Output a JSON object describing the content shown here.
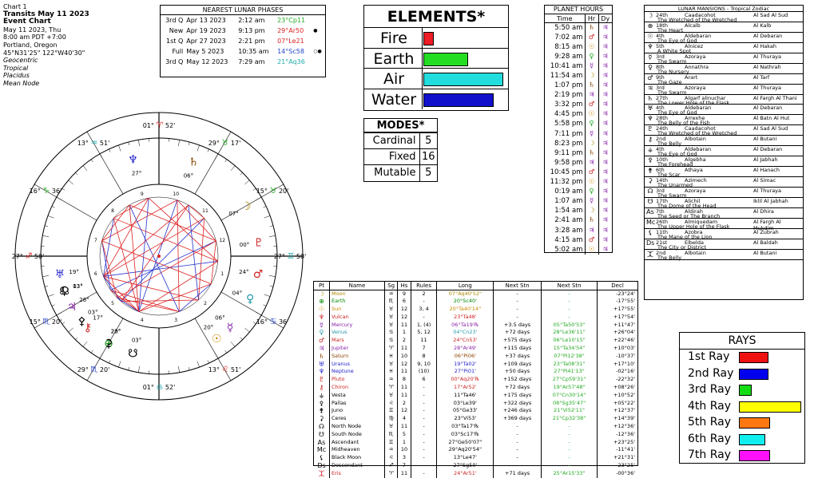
{
  "info": {
    "line1": "Chart 1",
    "line2": "Transits May 11 2023",
    "line3": "Event Chart",
    "line4": "May 11 2023, Thu",
    "line5": "8:00 am  PDT +7:00",
    "line6": "Portland, Oregon",
    "line7": "45°N31'25\"  122°W40'30\"",
    "line8": "Geocentric",
    "line9": "Tropical",
    "line10": "Placidus",
    "line11": "Mean Node"
  },
  "phases": {
    "title": "NEAREST LUNAR PHASES",
    "rows": [
      {
        "phase": "3rd Q",
        "date": "Apr 13 2023",
        "time": "2:12 am",
        "pos": "23°Cp11",
        "color": "#22aa22",
        "mark": ""
      },
      {
        "phase": "New",
        "date": "Apr 19 2023",
        "time": "9:13 pm",
        "pos": "29°Ar50",
        "color": "#dd2222",
        "mark": "●"
      },
      {
        "phase": "1st Q",
        "date": "Apr 27 2023",
        "time": "2:21 pm",
        "pos": "07°Le21",
        "color": "#dd2222",
        "mark": ""
      },
      {
        "phase": "Full",
        "date": "May 5 2023",
        "time": "10:35 am",
        "pos": "14°Sc58",
        "color": "#2244cc",
        "mark": "○●"
      },
      {
        "phase": "3rd Q",
        "date": "May 12 2023",
        "time": "7:29 am",
        "pos": "21°Aq36",
        "color": "#22aaaa",
        "mark": ""
      }
    ]
  },
  "elements": {
    "title": "ELEMENTS*",
    "items": [
      {
        "label": "Fire",
        "value": 2,
        "color": "#ee1c24"
      },
      {
        "label": "Earth",
        "value": 9,
        "color": "#22dd22"
      },
      {
        "label": "Air",
        "value": 16,
        "color": "#22dddd"
      },
      {
        "label": "Water",
        "value": 14,
        "color": "#1111cc"
      }
    ],
    "max": 16
  },
  "modes": {
    "title": "MODES*",
    "items": [
      {
        "label": "Cardinal",
        "value": "5"
      },
      {
        "label": "Fixed",
        "value": "16"
      },
      {
        "label": "Mutable",
        "value": "5"
      }
    ]
  },
  "hours": {
    "title": "PLANET HOURS",
    "headers": [
      "Time",
      "Hr",
      "Dy"
    ],
    "rows": [
      [
        "5:50 am",
        "♄",
        "♃"
      ],
      [
        "7:02 am",
        "♂",
        "♃"
      ],
      [
        "8:15 am",
        "☉",
        "♃"
      ],
      [
        "9:28 am",
        "♀",
        "♃"
      ],
      [
        "10:41 am",
        "☿",
        "♃"
      ],
      [
        "11:54 am",
        "☽",
        "♃"
      ],
      [
        "1:07 pm",
        "♄",
        "♃"
      ],
      [
        "2:19 pm",
        "♃",
        "♃"
      ],
      [
        "3:32 pm",
        "♂",
        "♃"
      ],
      [
        "4:45 pm",
        "☉",
        "♃"
      ],
      [
        "5:58 pm",
        "♀",
        "♃"
      ],
      [
        "7:11 pm",
        "☿",
        "♃"
      ],
      [
        "8:23 pm",
        "☽",
        "♃"
      ],
      [
        "9:11 pm",
        "♄",
        "♃"
      ],
      [
        "9:58 pm",
        "♃",
        "♃"
      ],
      [
        "10:45 pm",
        "♂",
        "♃"
      ],
      [
        "11:32 pm",
        "☉",
        "♃"
      ],
      [
        "0:19 am",
        "♀",
        "♃"
      ],
      [
        "1:07 am",
        "☿",
        "♃"
      ],
      [
        "1:54 am",
        "☽",
        "♃"
      ],
      [
        "2:41 am",
        "♄",
        "♃"
      ],
      [
        "3:28 am",
        "♃",
        "♃"
      ],
      [
        "4:15 am",
        "♂",
        "♃"
      ],
      [
        "5:02 am",
        "☉",
        "♃"
      ]
    ]
  },
  "mansions": {
    "title": "LUNAR MANSIONS - Tropical Zodiac",
    "rows": [
      {
        "g": "☽",
        "n": "24th",
        "a": "Caadacohot",
        "b": "Al Sad Al Sud",
        "d": "The Wretched of the Wretched"
      },
      {
        "g": "⊕",
        "n": "18th",
        "a": "Alcalb",
        "b": "Al Kalb",
        "d": "The Heart"
      },
      {
        "g": "☉",
        "n": "4th",
        "a": "Aldebaran",
        "b": "Al Debaran",
        "d": "The Eye of God"
      },
      {
        "g": "♆",
        "n": "5th",
        "a": "Alnicez",
        "b": "Al Hakah",
        "d": "A White Spot"
      },
      {
        "g": "☿",
        "n": "3rd",
        "a": "Azoraya",
        "b": "Al Thuraya",
        "d": "The Swarm"
      },
      {
        "g": "♀",
        "n": "8th",
        "a": "Annathra",
        "b": "Al Nathrah",
        "d": "The Nursery"
      },
      {
        "g": "♂",
        "n": "9th",
        "a": "Arart",
        "b": "Al Tarf",
        "d": "The Gaze"
      },
      {
        "g": "♃",
        "n": "3rd",
        "a": "Azoraya",
        "b": "Al Thuraya",
        "d": "The Swarm"
      },
      {
        "g": "♄",
        "n": "27th",
        "a": "Algarf alinuchar",
        "b": "Al Fargh Al Thani",
        "d": "The Lower Hole of the Flask"
      },
      {
        "g": "♅",
        "n": "4th",
        "a": "Aldebaran",
        "b": "Al Debaran",
        "d": "The Eye of God"
      },
      {
        "g": "♆",
        "n": "28th",
        "a": "Arrexhe",
        "b": "Al Batn Al Hut",
        "d": "The Belly of the Fish"
      },
      {
        "g": "♇",
        "n": "24th",
        "a": "Caadacohot",
        "b": "Al Sad Al Sud",
        "d": "The Wretched of the Wretched"
      },
      {
        "g": "⚷",
        "n": "2nd",
        "a": "Albotain",
        "b": "Al Butani",
        "d": "The Belly"
      },
      {
        "g": "⚶",
        "n": "4th",
        "a": "Aldebaran",
        "b": "Al Debaran",
        "d": "The Eye of God"
      },
      {
        "g": "⚴",
        "n": "10th",
        "a": "Algebha",
        "b": "Al Jabhah",
        "d": "The Forehead"
      },
      {
        "g": "⚵",
        "n": "6th",
        "a": "Athaya",
        "b": "Al Hanach",
        "d": "The Scar"
      },
      {
        "g": "⚳",
        "n": "14th",
        "a": "Azimech",
        "b": "Al Simac",
        "d": "The Unarmed"
      },
      {
        "g": "☊",
        "n": "3rd",
        "a": "Azoraya",
        "b": "Al Thuraya",
        "d": "The Swarm"
      },
      {
        "g": "☋",
        "n": "17th",
        "a": "Alichil",
        "b": "Iklil Al Jabhah",
        "d": "The Dome of the Head"
      },
      {
        "g": "As",
        "n": "7th",
        "a": "Aldirah",
        "b": "Al Dhira",
        "d": "The Seed or The Branch"
      },
      {
        "g": "Mc",
        "n": "26th",
        "a": "Almiquedam",
        "b": "Al Fargh Al Mukdim",
        "d": "The Upper Hole of the Flask"
      },
      {
        "g": "⚸",
        "n": "11th",
        "a": "Azobra",
        "b": "Al Zubrah",
        "d": "The Mane of the Lion"
      },
      {
        "g": "Ds",
        "n": "21st",
        "a": "Elbelda",
        "b": "Al Baldah",
        "d": "The City or District"
      },
      {
        "g": "⯰",
        "n": "2nd",
        "a": "Albotain",
        "b": "Al Butani",
        "d": "The Belly"
      }
    ]
  },
  "rays": {
    "title": "RAYS",
    "items": [
      {
        "label": "1st Ray",
        "value": 0.48,
        "color": "#ee1111"
      },
      {
        "label": "2nd Ray",
        "value": 0.48,
        "color": "#0000ee"
      },
      {
        "label": "3rd Ray",
        "value": 0.2,
        "color": "#11dd11"
      },
      {
        "label": "4th Ray",
        "value": 1.0,
        "color": "#ffff00"
      },
      {
        "label": "5th Ray",
        "value": 0.5,
        "color": "#ff7711"
      },
      {
        "label": "6th Ray",
        "value": 0.42,
        "color": "#11eeee"
      },
      {
        "label": "7th Ray",
        "value": 0.5,
        "color": "#ff11ff"
      }
    ]
  },
  "ptable": {
    "headers": [
      "Pt",
      "Name",
      "Sg",
      "Hs",
      "Rules",
      "Long",
      "Next Stn",
      "Next Stn",
      "Decl"
    ],
    "rows": [
      {
        "g": "☽",
        "name": "Moon",
        "sg": "♒",
        "hs": "9",
        "ru": "2",
        "long": "07°Aq40'52\"",
        "n1": "-",
        "n2": "-",
        "decl": "-23°24'",
        "col": "#aa8800"
      },
      {
        "g": "⊕",
        "name": "Earth",
        "sg": "♏",
        "hs": "6",
        "ru": "-",
        "long": "20°Sc40'",
        "n1": "-",
        "n2": "-",
        "decl": "-17°55'",
        "col": "#008800"
      },
      {
        "g": "☉",
        "name": "Sun",
        "sg": "♉",
        "hs": "12",
        "ru": "3, 4",
        "long": "20°Ta40'14\"",
        "n1": "-",
        "n2": "-",
        "decl": "+17°55'",
        "col": "#cc8800"
      },
      {
        "g": "♆",
        "name": "Vulcan",
        "sg": "♉",
        "hs": "12",
        "ru": "-",
        "long": "23°Ta48'",
        "n1": "-",
        "n2": "-",
        "decl": "+17°54'",
        "col": "#cc2222"
      },
      {
        "g": "☿",
        "name": "Mercury",
        "sg": "♉",
        "hs": "11",
        "ru": "1, (4)",
        "long": "06°Ta19'℞",
        "n1": "+3.5 days",
        "n2": "05°Ta50'53\"",
        "decl": "+11°47'",
        "col": "#8822aa"
      },
      {
        "g": "♀",
        "name": "Venus",
        "sg": "♋",
        "hs": "1",
        "ru": "5, 12",
        "long": "04°Cn23'",
        "n1": "+72 days",
        "n2": "28°Le36'11\"",
        "decl": "+26°04'",
        "col": "#2299aa"
      },
      {
        "g": "♂",
        "name": "Mars",
        "sg": "♋",
        "hs": "2",
        "ru": "11",
        "long": "24°Cn53'",
        "n1": "+575 days",
        "n2": "06°Le10'15\"",
        "decl": "+22°46'",
        "col": "#cc2222"
      },
      {
        "g": "♃",
        "name": "Jupiter",
        "sg": "♈",
        "hs": "11",
        "ru": "7",
        "long": "28°Ar49'",
        "n1": "+115 days",
        "n2": "15°Ta34'54\"",
        "decl": "+10°03'",
        "col": "#8822aa"
      },
      {
        "g": "♄",
        "name": "Saturn",
        "sg": "♓",
        "hs": "10",
        "ru": "8",
        "long": "06°Pi06'",
        "n1": "+37 days",
        "n2": "07°Pi12'38\"",
        "decl": "-10°37'",
        "col": "#884400"
      },
      {
        "g": "♅",
        "name": "Uranus",
        "sg": "♉",
        "hs": "12",
        "ru": "9, 10",
        "long": "19°Ta02'",
        "n1": "+109 days",
        "n2": "23°Ta08'31\"",
        "decl": "+17°10'",
        "col": "#2222cc"
      },
      {
        "g": "♆",
        "name": "Neptune",
        "sg": "♓",
        "hs": "11",
        "ru": "(10)",
        "long": "27°Pi01'",
        "n1": "+50 days",
        "n2": "27°Pi41'13\"",
        "decl": "-02°16'",
        "col": "#2222cc"
      },
      {
        "g": "♇",
        "name": "Pluto",
        "sg": "♒",
        "hs": "8",
        "ru": "6",
        "long": "00°Aq20'℞",
        "n1": "+152 days",
        "n2": "27°Cp59'31\"",
        "decl": "-22°32'",
        "col": "#cc2222"
      },
      {
        "g": "⚷",
        "name": "Chiron",
        "sg": "♈",
        "hs": "11",
        "ru": "-",
        "long": "17°Ar52'",
        "n1": "+72 days",
        "n2": "19°Ar57'48\"",
        "decl": "+08°26'",
        "col": "#cc2222"
      },
      {
        "g": "⚶",
        "name": "Vesta",
        "sg": "♉",
        "hs": "11",
        "ru": "-",
        "long": "11°Ta46'",
        "n1": "+175 days",
        "n2": "07°Cn30'14\"",
        "decl": "+10°52'",
        "col": "#000000"
      },
      {
        "g": "⚴",
        "name": "Pallas",
        "sg": "♌",
        "hs": "2",
        "ru": "-",
        "long": "03°Le39'",
        "n1": "+322 days",
        "n2": "08°Sg35'47\"",
        "decl": "+05°22'",
        "col": "#000000"
      },
      {
        "g": "⚵",
        "name": "Juno",
        "sg": "♊",
        "hs": "12",
        "ru": "-",
        "long": "05°Ge33'",
        "n1": "+246 days",
        "n2": "21°Vi52'11\"",
        "decl": "+12°37'",
        "col": "#000000"
      },
      {
        "g": "⚳",
        "name": "Ceres",
        "sg": "♍",
        "hs": "4",
        "ru": "-",
        "long": "23°Vi53'",
        "n1": "+369 days",
        "n2": "21°Cp32'38\"",
        "decl": "+14°39'",
        "col": "#000000"
      },
      {
        "g": "☊",
        "name": "North Node",
        "sg": "♉",
        "hs": "11",
        "ru": "-",
        "long": "03°Ta17'℞",
        "n1": "-",
        "n2": "-",
        "decl": "+12°36'",
        "col": "#000000"
      },
      {
        "g": "☋",
        "name": "South Node",
        "sg": "♏",
        "hs": "5",
        "ru": "-",
        "long": "03°Sc17'℞",
        "n1": "-",
        "n2": "-",
        "decl": "-12°36'",
        "col": "#000000"
      },
      {
        "g": "As",
        "name": "Ascendant",
        "sg": "♊",
        "hs": "1",
        "ru": "-",
        "long": "27°Ge50'07\"",
        "n1": "-",
        "n2": "-",
        "decl": "+23°25'",
        "col": "#000000"
      },
      {
        "g": "Mc",
        "name": "Midheaven",
        "sg": "♒",
        "hs": "10",
        "ru": "-",
        "long": "29°Aq20'54\"",
        "n1": "-",
        "n2": "-",
        "decl": "-11°41'",
        "col": "#000000"
      },
      {
        "g": "⚸",
        "name": "Black Moon",
        "sg": "♌",
        "hs": "3",
        "ru": "-",
        "long": "13°Le47'",
        "n1": "-",
        "n2": "-",
        "decl": "+21°31'",
        "col": "#000000"
      },
      {
        "g": "Ds",
        "name": "Descendant",
        "sg": "♐",
        "hs": "7",
        "ru": "-",
        "long": "27°Sg50'",
        "n1": "-",
        "n2": "-",
        "decl": "-23°25'",
        "col": "#000000"
      },
      {
        "g": "⯰",
        "name": "Eris",
        "sg": "♈",
        "hs": "11",
        "ru": "-",
        "long": "24°Ar51'",
        "n1": "+71 days",
        "n2": "25°Ar15'33\"",
        "decl": "-00°36'",
        "col": "#cc2222"
      }
    ]
  },
  "wheel": {
    "cusps": [
      {
        "deg": "01°",
        "sign": "♈",
        "min": "52'",
        "color": "#dd2222"
      },
      {
        "deg": "29°",
        "sign": "♉",
        "min": "17'",
        "color": "#22aa22"
      },
      {
        "deg": "15°",
        "sign": "♉",
        "min": "20'",
        "color": "#22aa22"
      },
      {
        "deg": "27°",
        "sign": "♊",
        "min": "50'",
        "color": "#22aaaa"
      },
      {
        "deg": "16°",
        "sign": "♋",
        "min": "36'",
        "color": "#2244cc"
      },
      {
        "deg": "13°",
        "sign": "♌",
        "min": "51'",
        "color": "#dd2222"
      },
      {
        "deg": "01°",
        "sign": "♎",
        "min": "52'",
        "color": "#22aaaa"
      },
      {
        "deg": "29°",
        "sign": "♏",
        "min": "20'",
        "color": "#2244cc"
      },
      {
        "deg": "15°",
        "sign": "♏",
        "min": "20'",
        "color": "#2244cc"
      },
      {
        "deg": "27°",
        "sign": "♐",
        "min": "50'",
        "color": "#dd2222"
      },
      {
        "deg": "16°",
        "sign": "♑",
        "min": "36'",
        "color": "#22aa22"
      },
      {
        "deg": "13°",
        "sign": "♒",
        "min": "51'",
        "color": "#22aaaa"
      }
    ],
    "planets": [
      {
        "g": "♆",
        "lbl": "27°",
        "col": "#2222cc"
      },
      {
        "g": "♄",
        "lbl": "06°",
        "col": "#884400"
      },
      {
        "g": "☽",
        "lbl": "07°",
        "col": "#aa8800"
      },
      {
        "g": "♇",
        "lbl": "00°",
        "col": "#cc2222"
      },
      {
        "g": "♂",
        "lbl": "24°",
        "col": "#cc2222"
      },
      {
        "g": "♀",
        "lbl": "04°",
        "col": "#2299aa"
      },
      {
        "g": "☿",
        "lbl": "06°",
        "col": "#8822aa"
      },
      {
        "g": "☉",
        "lbl": "20°",
        "col": "#cc8800"
      },
      {
        "g": "♅",
        "lbl": "19°",
        "col": "#2222cc"
      },
      {
        "g": "☊",
        "lbl": "03°",
        "col": "#000000"
      },
      {
        "g": "♃",
        "lbl": "28°",
        "col": "#8822aa"
      },
      {
        "g": "⚷",
        "lbl": "17°",
        "col": "#cc2222"
      },
      {
        "g": "⊕",
        "lbl": "20°",
        "col": "#008800"
      },
      {
        "g": "☋",
        "lbl": "03°",
        "col": "#000000"
      },
      {
        "g": "⚳",
        "lbl": "23°",
        "col": "#000000"
      },
      {
        "g": "⚴",
        "lbl": "03°",
        "col": "#000000"
      },
      {
        "g": "⚸",
        "lbl": "13°",
        "col": "#000000"
      }
    ]
  }
}
